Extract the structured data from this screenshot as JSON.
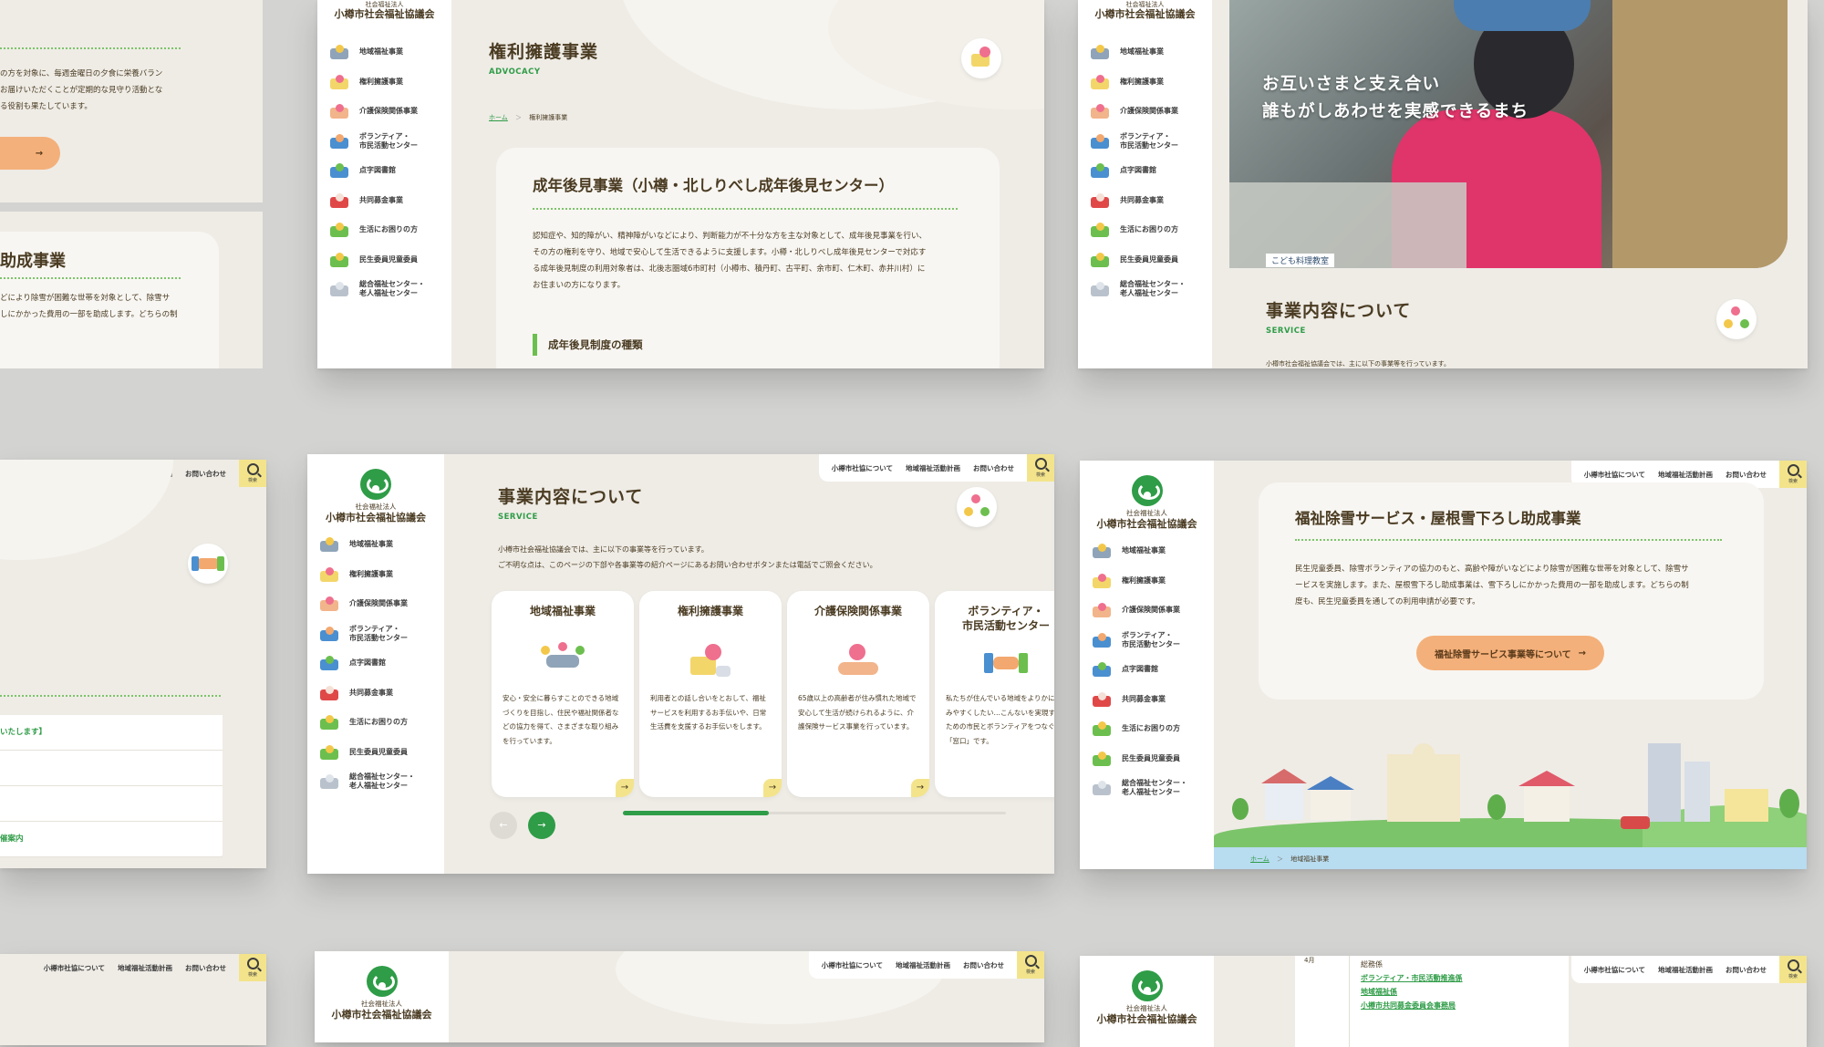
{
  "nav_items": [
    {
      "label": "地域福祉事業",
      "icon": "community-icon"
    },
    {
      "label": "権利擁護事業",
      "icon": "heart-document-icon"
    },
    {
      "label": "介護保険関係事業",
      "icon": "care-hand-icon"
    },
    {
      "label": "ボランティア・\n市民活動センター",
      "icon": "handshake-icon"
    },
    {
      "label": "点字図書館",
      "icon": "books-icon"
    },
    {
      "label": "共同募金事業",
      "icon": "red-feather-icon"
    },
    {
      "label": "生活にお困りの方",
      "icon": "family-icon"
    },
    {
      "label": "民生委員児童委員",
      "icon": "house-icon"
    },
    {
      "label": "総合福祉センター・\n老人福祉センター",
      "icon": "building-icon"
    }
  ],
  "brand": {
    "subtitle": "社会福祉法人",
    "name": "小樽市社会福祉協議会"
  },
  "header_links": [
    "小樽市社協について",
    "地域福祉活動計画",
    "お問い合わせ"
  ],
  "search_label": "検索",
  "card_top_left": {
    "text_lines": [
      "の方を対象に、毎週金曜日の夕食に栄養バラン",
      "お届けいただくことが定期的な見守り活動とな",
      "る役割も果たしています。"
    ],
    "button_arrow": "→",
    "next_title": "助成事業",
    "next_lines": [
      "どにより除雪が困難な世帯を対象として、除雪サ",
      "しにかかった費用の一部を助成します。どちらの制"
    ]
  },
  "card_advocacy": {
    "title": "権利擁護事業",
    "title_en": "ADVOCACY",
    "breadcrumb_home": "ホーム",
    "breadcrumb_sep": "＞",
    "breadcrumb_current": "権利擁護事業",
    "panel_title": "成年後見事業（小樽・北しりべし成年後見センター）",
    "panel_lines": [
      "認知症や、知的障がい、精神障がいなどにより、判断能力が不十分な方を主な対象として、成年後見事業を行い、",
      "その方の権利を守り、地域で安心して生活できるように支援します。小樽・北しりべし成年後見センターで対応す",
      "る成年後見制度の利用対象者は、北後志圏域6市町村（小樽市、積丹町、古平町、余市町、仁木町、赤井川村）に",
      "お住まいの方になります。"
    ],
    "sub_heading": "成年後見制度の種類"
  },
  "card_hero": {
    "catch_line1": "お互いさまと支え合い",
    "catch_line2": "誰もがしあわせを実感できるまち",
    "photo_sign": "こども料理教室",
    "section_title": "事業内容について",
    "section_en": "SERVICE",
    "intro_cut": "小樽市社会福祉協議会では、主に以下の事業等を行っています。"
  },
  "card_mid_left": {
    "list_rows": [
      "いたします】",
      "",
      "",
      "催案内"
    ]
  },
  "card_services": {
    "title": "事業内容について",
    "title_en": "SERVICE",
    "intro_line1": "小樽市社会福祉協議会では、主に以下の事業等を行っています。",
    "intro_line2": "ご不明な点は、このページの下部や各事業等の紹介ページにあるお問い合わせボタンまたは電話でご照会ください。",
    "cards": [
      {
        "title": "地域福祉事業",
        "desc": "安心・安全に暮らすことのできる地域づくりを目指し、住民や福祉関係者などの協力を得て、さまざまな取り組みを行っています。"
      },
      {
        "title": "権利擁護事業",
        "desc": "利用者との話し合いをとおして、福祉サービスを利用するお手伝いや、日常生活費を支援するお手伝いをします。"
      },
      {
        "title": "介護保険関係事業",
        "desc": "65歳以上の高齢者が住み慣れた地域で安心して生活が続けられるように、介護保険サービス事業を行っています。"
      },
      {
        "title": "ボランティア・\n市民活動センター",
        "desc": "私たちが住んでいる地域をよりかに住みやすくしたい…こんないを実現するための市民とボランティアをつなぐ「窓口」です。"
      }
    ],
    "prev_arrow": "←",
    "next_arrow": "→",
    "card_arrow": "→",
    "carousel_progress": 0.38
  },
  "card_snow": {
    "title": "福祉除雪サービス・屋根雪下ろし助成事業",
    "lines": [
      "民生児童委員、除雪ボランティアの協力のもと、高齢や障がいなどにより除雪が困難な世帯を対象として、除雪サ",
      "ービスを実施します。また、屋根雪下ろし助成事業は、雪下ろしにかかった費用の一部を助成します。どちらの制",
      "度も、民生児童委員を通しての利用申請が必要です。"
    ],
    "button": "福祉除雪サービス事業等について",
    "button_arrow": "→",
    "breadcrumb_home": "ホーム",
    "breadcrumb_sep": "＞",
    "breadcrumb_current": "地域福祉事業"
  },
  "card_bottom_right": {
    "links_top": "4月",
    "links": [
      "総務係",
      "ボランティア・市民活動推進係",
      "地域福祉係",
      "小樽市共同募金委員会事務局"
    ]
  },
  "colors": {
    "background": "#d3d3d1",
    "page_beige": "#efece6",
    "accent_green": "#2f9c47",
    "accent_yellow": "#f3e48c",
    "accent_orange": "#f4b07a",
    "text_brown": "#4a3b22"
  }
}
